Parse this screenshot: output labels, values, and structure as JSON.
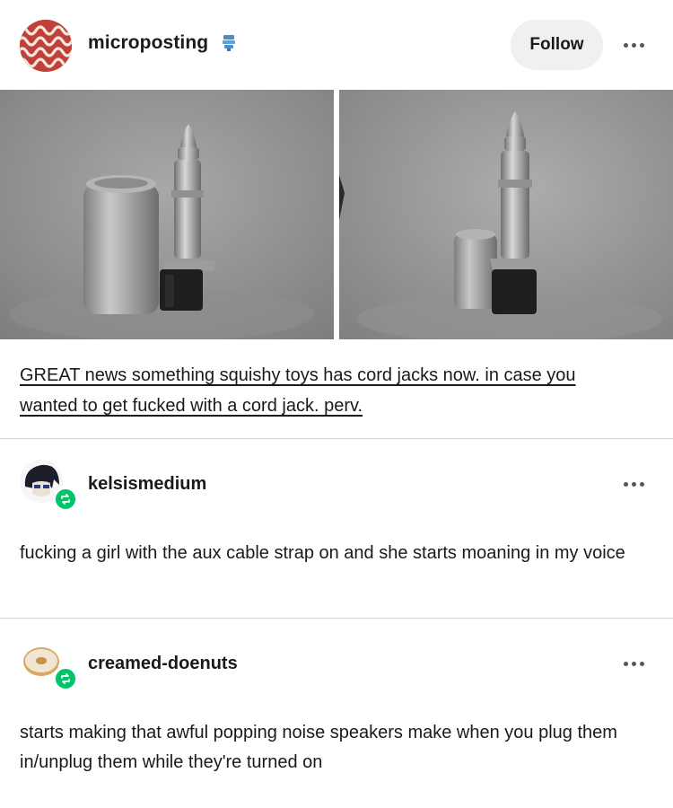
{
  "post": {
    "username": "microposting",
    "follow_label": "Follow",
    "caption_line1": "GREAT news something squishy toys has cord jacks now. in case you",
    "caption_line2": "wanted to get fucked with a cord jack. perv."
  },
  "reblogs": [
    {
      "username": "kelsismedium",
      "text": "fucking a girl with the aux cable strap on and she starts moaning in my voice"
    },
    {
      "username": "creamed-doenuts",
      "text": "starts making that awful popping noise speakers make when you plug them in/unplug them while they're turned on"
    }
  ],
  "colors": {
    "reblog_badge": "#00c46a",
    "follow_bg": "#eef0f2",
    "avatar_main": "#c1413a"
  },
  "icons": [
    "more-options-icon",
    "reblog-icon",
    "blog-badge-icon"
  ]
}
